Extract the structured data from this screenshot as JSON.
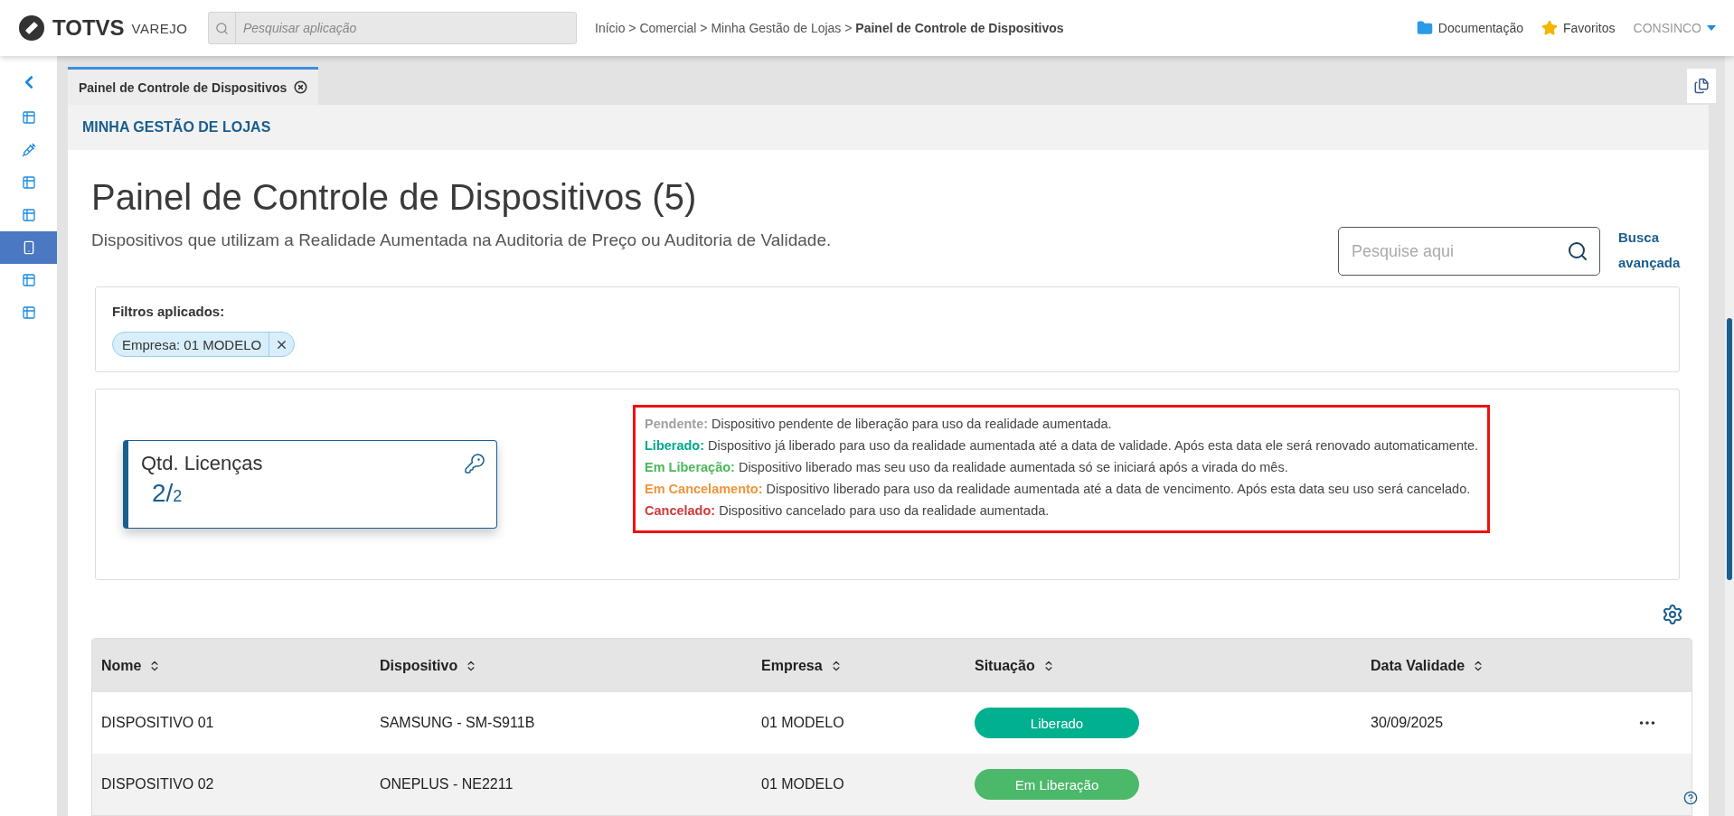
{
  "header": {
    "logo_text": "TOTVS",
    "logo_sub": "VAREJO",
    "search_placeholder": "Pesquisar aplicação",
    "breadcrumb": "Início > Comercial > Minha Gestão de Lojas > **Painel de Controle de Dispositivos**",
    "links": [
      "Documentação",
      "Favoritos"
    ],
    "user": "CONSINCO"
  },
  "sidebar": {
    "items": [
      {
        "kind": "table",
        "selected": false
      },
      {
        "kind": "syringe",
        "selected": false
      },
      {
        "kind": "table",
        "selected": false
      },
      {
        "kind": "table",
        "selected": false
      },
      {
        "kind": "phone",
        "selected": true
      },
      {
        "kind": "table",
        "selected": false
      },
      {
        "kind": "table",
        "selected": false
      }
    ]
  },
  "tabs": [
    {
      "label": "Painel de Controle de Dispositivos",
      "selected": true
    }
  ],
  "section": "MINHA GESTÃO DE LOJAS",
  "page": {
    "title": "Painel de Controle de Dispositivos (5)",
    "subtitle": "Dispositivos que utilizam a Realidade Aumentada na Auditoria de Preço ou Auditoria de Validade.",
    "search_placeholder": "Pesquise aqui",
    "advanced_search": "Busca avançada"
  },
  "filters": {
    "label": "Filtros aplicados:",
    "chips": [
      "Empresa: 01 MODELO"
    ]
  },
  "license_card": {
    "title": "Qtd. Licenças",
    "value": "2/",
    "total": "2"
  },
  "legend": [
    {
      "status": "Pendente:",
      "color": "#a0a0a0",
      "text": "Dispositivo pendente de liberação para uso da realidade aumentada."
    },
    {
      "status": "Liberado:",
      "color": "#00a88a",
      "text": "Dispositivo já liberado para uso da realidade aumentada até a data de validade. Após esta data ele será renovado automaticamente."
    },
    {
      "status": "Em Liberação:",
      "color": "#4cb85c",
      "text": "Dispositivo liberado mas seu uso da realidade aumentada só se iniciará após a virada do mês."
    },
    {
      "status": "Em Cancelamento:",
      "color": "#f0953a",
      "text": "Dispositivo liberado para uso da realidade aumentada até a data de vencimento. Após esta data seu uso será cancelado."
    },
    {
      "status": "Cancelado:",
      "color": "#d03a3a",
      "text": "Dispositivo cancelado para uso da realidade aumentada."
    }
  ],
  "table": {
    "columns": [
      "Nome",
      "Dispositivo",
      "Empresa",
      "Situação",
      "Data Validade"
    ],
    "rows": [
      {
        "nome": "DISPOSITIVO 01",
        "dispositivo": "SAMSUNG - SM-S911B",
        "empresa": "01 MODELO",
        "status": {
          "label": "Liberado",
          "color": "#00b08e"
        },
        "validade": "30/09/2025"
      },
      {
        "nome": "DISPOSITIVO 02",
        "dispositivo": "ONEPLUS - NE2211",
        "empresa": "01 MODELO",
        "status": {
          "label": "Em Liberação",
          "color": "#4cb86a"
        },
        "validade": ""
      }
    ]
  }
}
